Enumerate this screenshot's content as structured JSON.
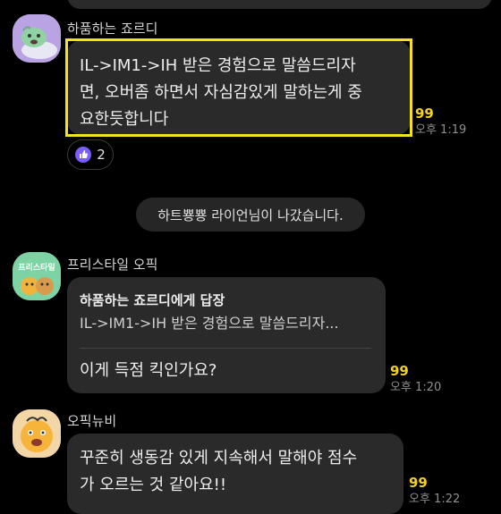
{
  "messages": [
    {
      "sender": "하품하는 죠르디",
      "text_lines": [
        "IL->IM1->IH 받은 경험으로 말씀드리자",
        "면, 오버좀 하면서 자심감있게 말하는게 중",
        "요한듯합니다"
      ],
      "count": "99",
      "time": "오후 1:19",
      "reaction": {
        "icon": "thumbs-up-icon",
        "count": "2"
      }
    },
    {
      "system": "하트뿅뿅 라이언님이 나갔습니다."
    },
    {
      "sender": "프리스타일 오픽",
      "avatar_label": "프리스타일",
      "reply_title": "하품하는 죠르디에게 답장",
      "reply_quote": "IL->IM1->IH 받은 경험으로 말씀드리자...",
      "text": "이게 득점 킥인가요?",
      "count": "99",
      "time": "오후 1:20"
    },
    {
      "sender": "오픽뉴비",
      "text_lines": [
        "꾸준히 생동감 있게 지속해서 말해야 점수",
        "가 오르는 것 같아요!!"
      ],
      "count": "99",
      "time": "오후 1:22"
    }
  ],
  "colors": {
    "background": "#000000",
    "bubble": "#2a2a2a",
    "highlight": "#f6e21c",
    "unread_count": "#f6d11c",
    "reaction_icon": "#7b5cff"
  }
}
